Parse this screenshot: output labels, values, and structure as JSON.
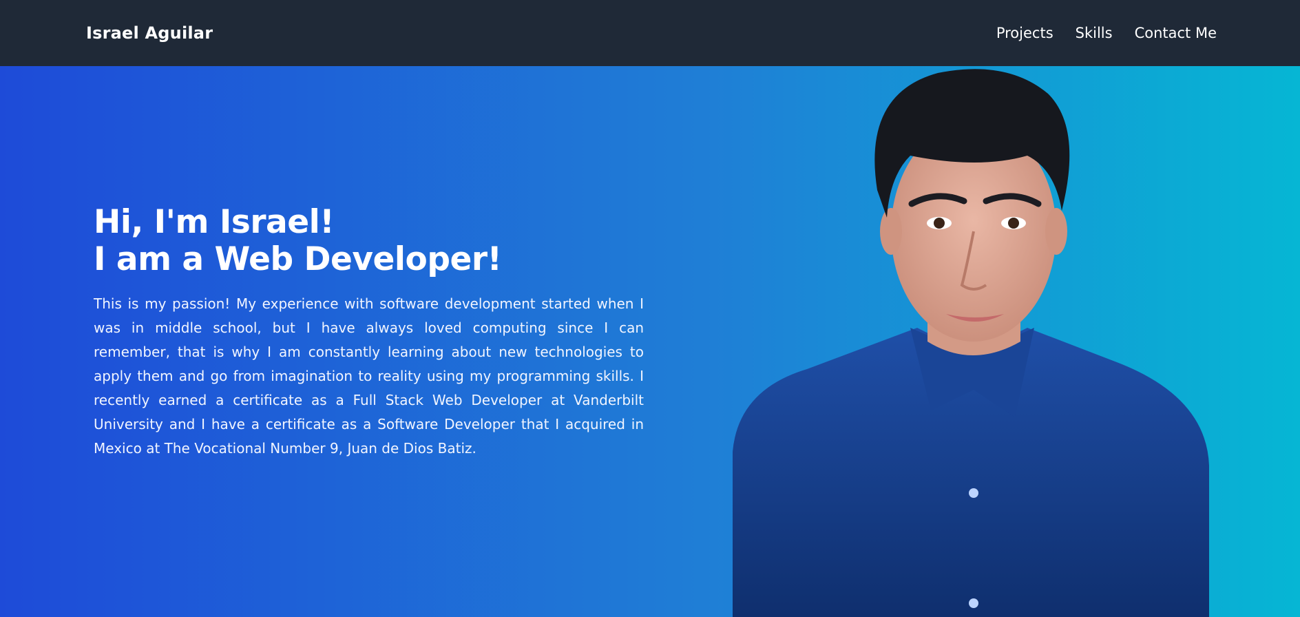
{
  "nav": {
    "brand": "Israel Aguilar",
    "links": [
      "Projects",
      "Skills",
      "Contact Me"
    ]
  },
  "hero": {
    "title_line1": "Hi, I'm Israel!",
    "title_line2": "I am a Web Developer!",
    "paragraph": "This is my passion! My experience with software development started when I was in middle school, but I have always loved computing since I can remember, that is why I am constantly learning about new technologies to apply them and go from imagination to reality using my programming skills. I recently earned a certificate as a Full Stack Web Developer at Vanderbilt University and I have a certificate as a Software Developer that I acquired in Mexico at The Vocational Number 9, Juan de Dios Batiz."
  },
  "colors": {
    "navbar_bg": "#1f2937",
    "hero_gradient_start": "#1e4bd8",
    "hero_gradient_end": "#06b6d4",
    "shirt": "#123d8f"
  }
}
